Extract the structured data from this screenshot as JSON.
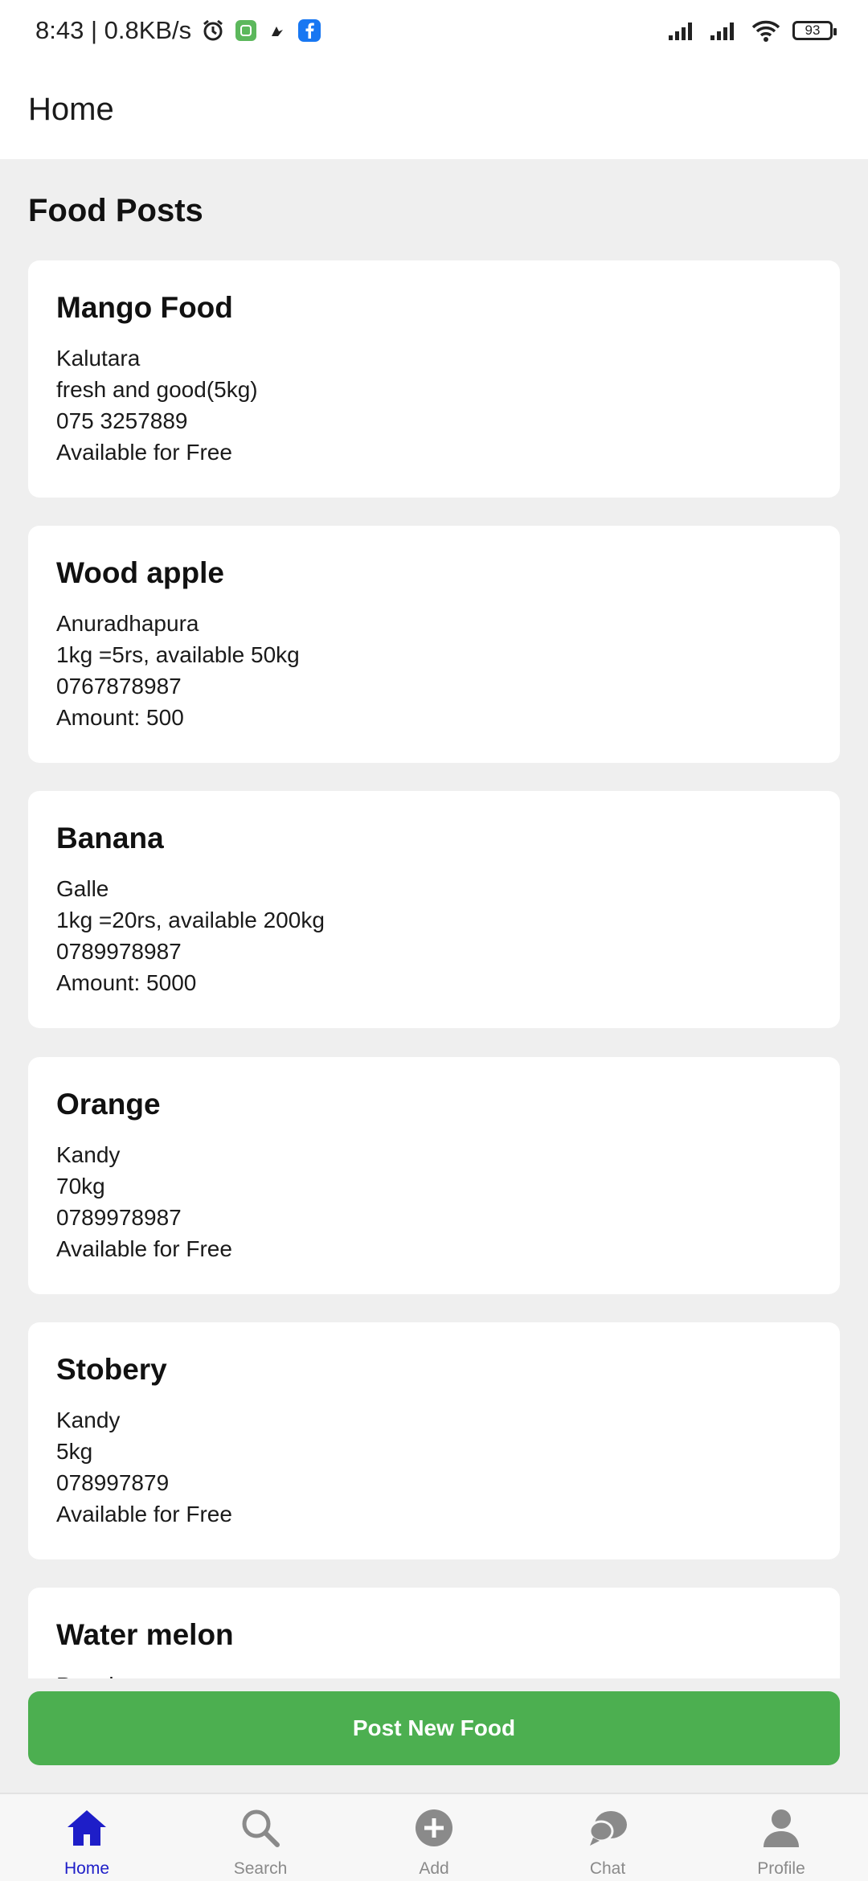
{
  "status_bar": {
    "time_speed": "8:43 | 0.8KB/s",
    "battery": "93"
  },
  "app_bar": {
    "title": "Home"
  },
  "section": {
    "title": "Food Posts"
  },
  "posts": [
    {
      "title": "Mango Food",
      "location": "Kalutara",
      "description": "fresh and good(5kg)",
      "phone": "075 3257889",
      "price": "Available for Free"
    },
    {
      "title": "Wood apple",
      "location": "Anuradhapura",
      "description": "1kg =5rs, available 50kg",
      "phone": "0767878987",
      "price": "Amount: 500"
    },
    {
      "title": "Banana",
      "location": "Galle",
      "description": "1kg =20rs, available 200kg",
      "phone": "0789978987",
      "price": "Amount: 5000"
    },
    {
      "title": "Orange",
      "location": "Kandy",
      "description": "70kg",
      "phone": "0789978987",
      "price": "Available for Free"
    },
    {
      "title": "Stobery",
      "location": "Kandy",
      "description": "5kg",
      "phone": "078997879",
      "price": "Available for Free"
    },
    {
      "title": "Water melon",
      "location": "Puttalam",
      "description": "",
      "phone": "",
      "price": ""
    }
  ],
  "post_button": {
    "label": "Post New Food"
  },
  "bottom_nav": [
    {
      "label": "Home",
      "icon": "home-icon",
      "active": true
    },
    {
      "label": "Search",
      "icon": "search-icon",
      "active": false
    },
    {
      "label": "Add",
      "icon": "add-circle-icon",
      "active": false
    },
    {
      "label": "Chat",
      "icon": "chat-icon",
      "active": false
    },
    {
      "label": "Profile",
      "icon": "profile-icon",
      "active": false
    }
  ],
  "colors": {
    "accent_green": "#4caf50",
    "nav_active": "#1e1ec8",
    "nav_inactive": "#8a8a8a",
    "background": "#efefef"
  }
}
